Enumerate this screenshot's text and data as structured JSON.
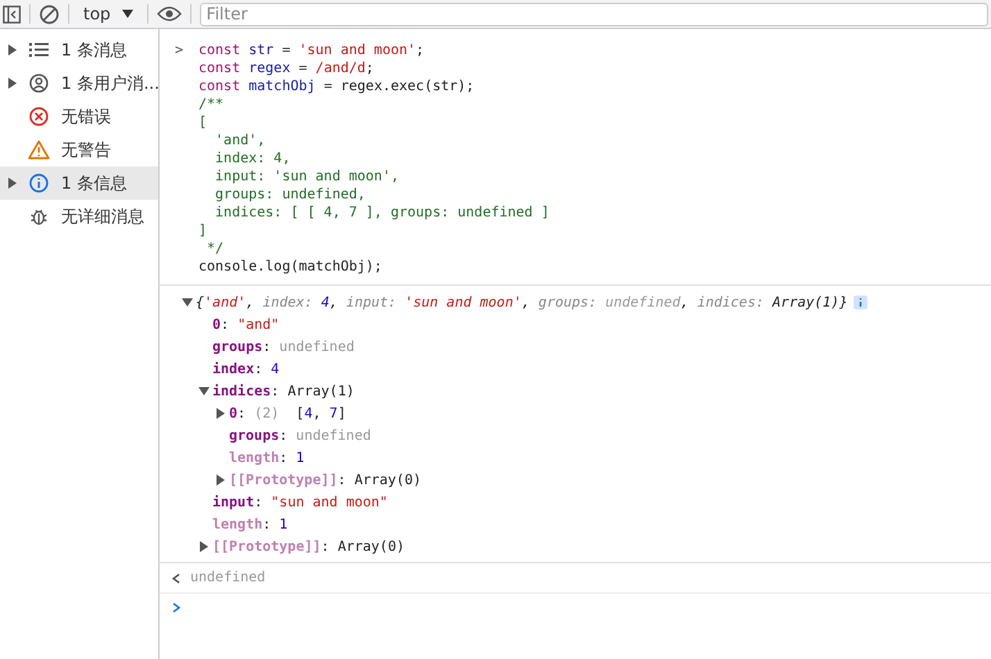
{
  "toolbar": {
    "context": "top",
    "filter": {
      "placeholder": "Filter"
    }
  },
  "sidebar": {
    "items": [
      {
        "label": "1 条消息",
        "kind": "list",
        "expandable": true,
        "selected": false
      },
      {
        "label": "1 条用户消...",
        "kind": "user",
        "expandable": true,
        "selected": false
      },
      {
        "label": "无错误",
        "kind": "error",
        "expandable": false,
        "selected": false
      },
      {
        "label": "无警告",
        "kind": "warning",
        "expandable": false,
        "selected": false
      },
      {
        "label": "1 条信息",
        "kind": "info",
        "expandable": true,
        "selected": true
      },
      {
        "label": "无详细消息",
        "kind": "bug",
        "expandable": false,
        "selected": false
      }
    ]
  },
  "input": {
    "prompt": ">",
    "lines": [
      [
        {
          "text": "const ",
          "kind": "keyword"
        },
        {
          "text": "str",
          "kind": "var"
        },
        {
          "text": " = ",
          "kind": "plain"
        },
        {
          "text": "'sun and moon'",
          "kind": "str"
        },
        {
          "text": ";",
          "kind": "plain"
        }
      ],
      [
        {
          "text": "const ",
          "kind": "keyword"
        },
        {
          "text": "regex",
          "kind": "var"
        },
        {
          "text": " = ",
          "kind": "plain"
        },
        {
          "text": "/and/d",
          "kind": "str"
        },
        {
          "text": ";",
          "kind": "plain"
        }
      ],
      [
        {
          "text": "const ",
          "kind": "keyword"
        },
        {
          "text": "matchObj",
          "kind": "var"
        },
        {
          "text": " = regex.exec(str);",
          "kind": "plain"
        }
      ],
      [
        {
          "text": "/**",
          "kind": "comment"
        }
      ],
      [
        {
          "text": "[",
          "kind": "comment"
        }
      ],
      [
        {
          "text": "  'and',",
          "kind": "comment"
        }
      ],
      [
        {
          "text": "  index: 4,",
          "kind": "comment"
        }
      ],
      [
        {
          "text": "  input: 'sun and moon',",
          "kind": "comment"
        }
      ],
      [
        {
          "text": "  groups: undefined,",
          "kind": "comment"
        }
      ],
      [
        {
          "text": "  indices: [ [ 4, 7 ], groups: undefined ]",
          "kind": "comment"
        }
      ],
      [
        {
          "text": "]",
          "kind": "comment"
        }
      ],
      [
        {
          "text": " */",
          "kind": "comment"
        }
      ],
      [
        {
          "text": "console.log(matchObj);",
          "kind": "plain"
        }
      ]
    ]
  },
  "output": {
    "expanded": true,
    "tokens": [
      {
        "text": "{",
        "kind": "plain"
      },
      {
        "text": "'and'",
        "kind": "str"
      },
      {
        "text": ", ",
        "kind": "plain"
      },
      {
        "text": "index",
        "kind": "skey"
      },
      {
        "text": ": ",
        "kind": "skey"
      },
      {
        "text": "4",
        "kind": "num"
      },
      {
        "text": ", ",
        "kind": "plain"
      },
      {
        "text": "input",
        "kind": "skey"
      },
      {
        "text": ": ",
        "kind": "skey"
      },
      {
        "text": "'sun and moon'",
        "kind": "str"
      },
      {
        "text": ", ",
        "kind": "plain"
      },
      {
        "text": "groups",
        "kind": "skey"
      },
      {
        "text": ": ",
        "kind": "skey"
      },
      {
        "text": "undefined",
        "kind": "undef"
      },
      {
        "text": ", ",
        "kind": "plain"
      },
      {
        "text": "indices",
        "kind": "skey"
      },
      {
        "text": ": ",
        "kind": "skey"
      },
      {
        "text": "Array(1)",
        "kind": "plain"
      },
      {
        "text": "}",
        "kind": "plain"
      }
    ],
    "children": [
      {
        "tokens": [
          {
            "text": "0",
            "kind": "key"
          },
          {
            "text": ": ",
            "kind": "plain"
          },
          {
            "text": "\"and\"",
            "kind": "str"
          }
        ]
      },
      {
        "tokens": [
          {
            "text": "groups",
            "kind": "key"
          },
          {
            "text": ": ",
            "kind": "plain"
          },
          {
            "text": "undefined",
            "kind": "undef"
          }
        ]
      },
      {
        "tokens": [
          {
            "text": "index",
            "kind": "key"
          },
          {
            "text": ": ",
            "kind": "plain"
          },
          {
            "text": "4",
            "kind": "num"
          }
        ]
      },
      {
        "expanded": true,
        "tokens": [
          {
            "text": "indices",
            "kind": "key"
          },
          {
            "text": ": ",
            "kind": "plain"
          },
          {
            "text": "Array(1)",
            "kind": "plain"
          }
        ],
        "children": [
          {
            "expanded": false,
            "tokens": [
              {
                "text": "0",
                "kind": "key"
              },
              {
                "text": ": ",
                "kind": "plain"
              },
              {
                "text": "(2)",
                "kind": "undef"
              },
              {
                "text": "  [",
                "kind": "plain"
              },
              {
                "text": "4",
                "kind": "num"
              },
              {
                "text": ", ",
                "kind": "plain"
              },
              {
                "text": "7",
                "kind": "num"
              },
              {
                "text": "]",
                "kind": "plain"
              }
            ]
          },
          {
            "tokens": [
              {
                "text": "groups",
                "kind": "key"
              },
              {
                "text": ": ",
                "kind": "plain"
              },
              {
                "text": "undefined",
                "kind": "undef"
              }
            ]
          },
          {
            "tokens": [
              {
                "text": "length",
                "kind": "dkey"
              },
              {
                "text": ": ",
                "kind": "plain"
              },
              {
                "text": "1",
                "kind": "num"
              }
            ]
          },
          {
            "expanded": false,
            "tokens": [
              {
                "text": "[[Prototype]]",
                "kind": "dkey"
              },
              {
                "text": ": ",
                "kind": "plain"
              },
              {
                "text": "Array(0)",
                "kind": "plain"
              }
            ]
          }
        ]
      },
      {
        "tokens": [
          {
            "text": "input",
            "kind": "key"
          },
          {
            "text": ": ",
            "kind": "plain"
          },
          {
            "text": "\"sun and moon\"",
            "kind": "str"
          }
        ]
      },
      {
        "tokens": [
          {
            "text": "length",
            "kind": "dkey"
          },
          {
            "text": ": ",
            "kind": "plain"
          },
          {
            "text": "1",
            "kind": "num"
          }
        ]
      },
      {
        "expanded": false,
        "tokens": [
          {
            "text": "[[Prototype]]",
            "kind": "dkey"
          },
          {
            "text": ": ",
            "kind": "plain"
          },
          {
            "text": "Array(0)",
            "kind": "plain"
          }
        ]
      }
    ]
  },
  "result": {
    "text": "undefined"
  }
}
